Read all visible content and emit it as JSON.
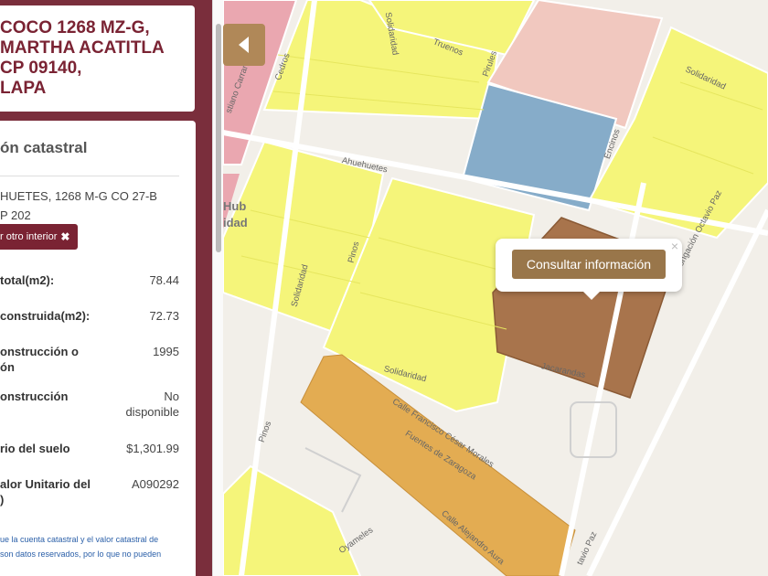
{
  "address": {
    "lines": [
      "COCO 1268 MZ-G,",
      "MARTHA ACATITLA",
      "CP 09140,",
      "LAPA"
    ]
  },
  "info": {
    "title": "ón catastral",
    "address_lines": [
      "HUETES, 1268 M-G CO 27-B",
      "P 202"
    ],
    "interior_button": "r otro interior",
    "interior_button_icon": "close-icon",
    "rows": [
      {
        "label": [
          "total(m2):"
        ],
        "value": [
          "78.44"
        ]
      },
      {
        "label": [
          "construida(m2):"
        ],
        "value": [
          "72.73"
        ]
      },
      {
        "label": [
          "onstrucción o",
          "ón"
        ],
        "value": [
          "1995"
        ]
      },
      {
        "label": [
          "onstrucción"
        ],
        "value": [
          "No",
          "disponible"
        ]
      },
      {
        "label": [
          "rio del suelo"
        ],
        "value": [
          "$1,301.99"
        ]
      },
      {
        "label": [
          "alor Unitario del",
          ")"
        ],
        "value": [
          "A090292"
        ]
      }
    ],
    "footnote": [
      "ue la cuenta catastral y el valor catastral de",
      "son datos reservados, por lo que no pueden"
    ]
  },
  "map": {
    "collapse_icon": "chevron-left-icon",
    "popup": {
      "button": "Consultar información",
      "close": "×"
    },
    "streets": {
      "truenos": "Truenos",
      "solidaridad_top": "Solidaridad",
      "solidaridad_right": "Solidaridad",
      "cedros": "Cedros",
      "pirules": "Pirules",
      "encinos": "Encinos",
      "ahuehuetes": "Ahuehuetes",
      "paz": "Prolongación Octavio Paz",
      "pinos_mid": "Pinos",
      "solidaridad_mid": "Solidaridad",
      "solidaridad_low": "Solidaridad",
      "jacarandas": "Jacarandas",
      "francisco": "Calle Francisco César Morales",
      "zaragoza": "Fuentes de Zaragoza",
      "pinos_low": "Pinos",
      "alejandro": "Calle Alejandro Aura",
      "oyameles": "Oyameles",
      "carranza": "stiano Carranza",
      "paz_low": "tavio Paz",
      "hub": "Hub",
      "dad": "idad"
    },
    "colors": {
      "yellow": "#f5f57a",
      "orange": "#e3ac52",
      "brown": "#a8744c",
      "blue": "#86acc9",
      "pink": "#f1c8bf",
      "rose": "#eaa7b0"
    }
  }
}
